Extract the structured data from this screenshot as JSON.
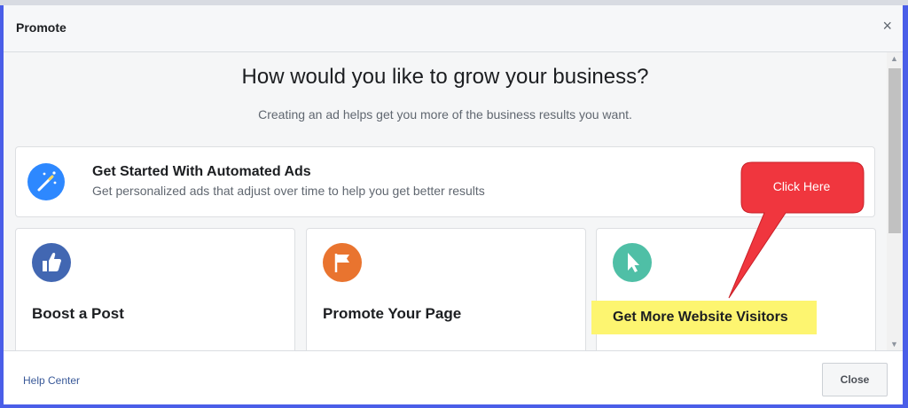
{
  "dialog": {
    "title": "Promote",
    "close_glyph": "×"
  },
  "main": {
    "heading": "How would you like to grow your business?",
    "subheading": "Creating an ad helps get you more of the business results you want."
  },
  "automated": {
    "title": "Get Started With Automated Ads",
    "subtitle": "Get personalized ads that adjust over time to help you get better results",
    "icon": "magic-wand-icon"
  },
  "options": [
    {
      "label": "Boost a Post",
      "icon": "thumbs-up-icon",
      "color": "#4267b2"
    },
    {
      "label": "Promote Your Page",
      "icon": "flag-icon",
      "color": "#e9742f"
    },
    {
      "label": "Get More Website Visitors",
      "icon": "cursor-icon",
      "color": "#4fbfa6"
    }
  ],
  "annotation": {
    "callout": "Click Here",
    "callout_color": "#f0363e",
    "highlight_color": "#fdf570"
  },
  "footer": {
    "help_link": "Help Center",
    "close_button": "Close"
  }
}
